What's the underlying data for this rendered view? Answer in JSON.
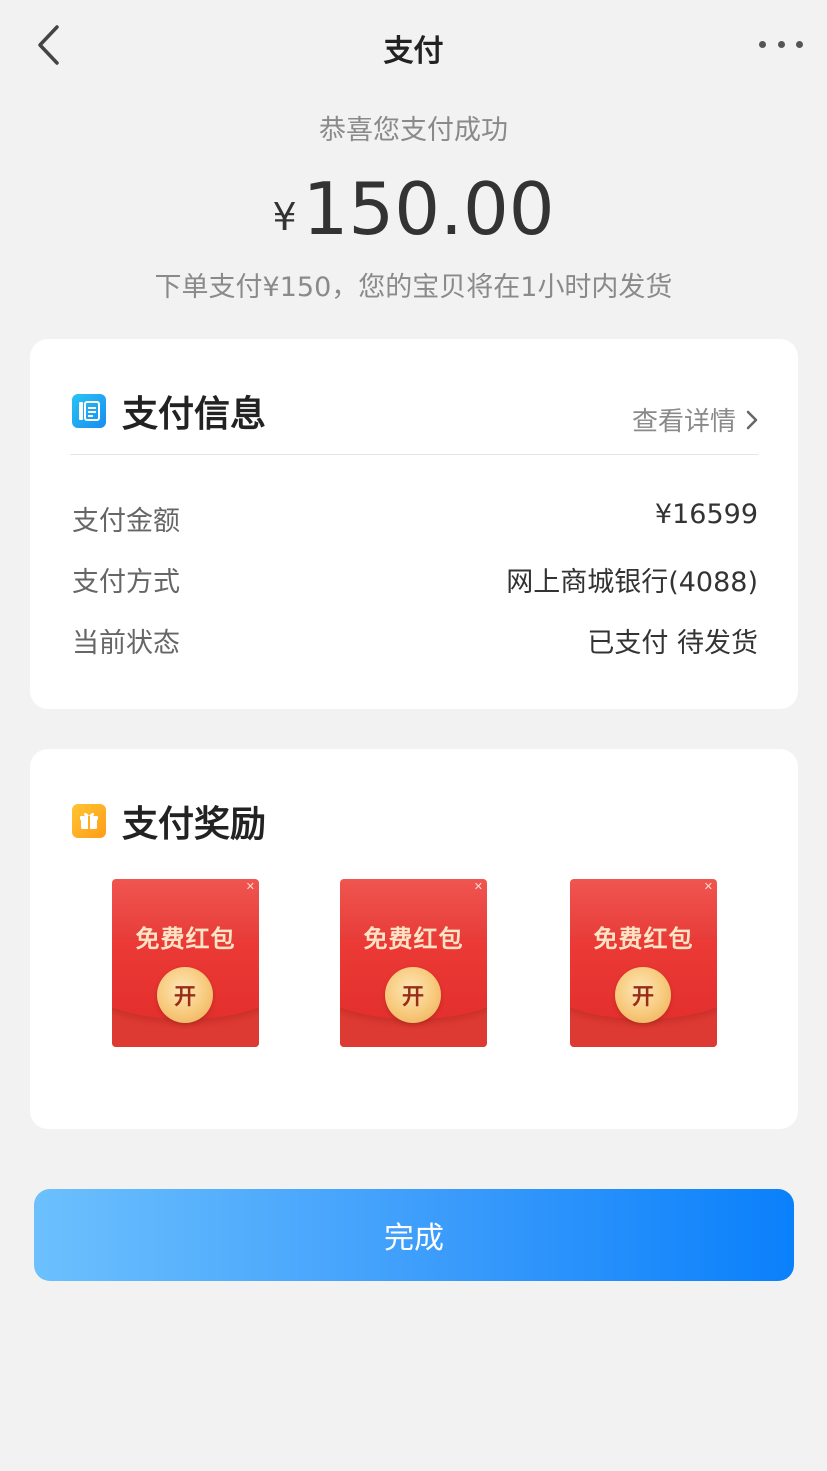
{
  "nav": {
    "title": "支付"
  },
  "hero": {
    "congrats": "恭喜您支付成功",
    "currency": "¥",
    "amount": "150.00",
    "note": "下单支付¥150，您的宝贝将在1小时内发货"
  },
  "payment_info": {
    "title": "支付信息",
    "detail_link": "查看详情",
    "rows": [
      {
        "label": "支付金额",
        "value": "¥16599"
      },
      {
        "label": "支付方式",
        "value": "网上商城银行(4088)"
      },
      {
        "label": "当前状态",
        "value": "已支付 待发货"
      }
    ]
  },
  "rewards": {
    "title": "支付奖励",
    "envelopes": [
      {
        "label": "免费红包",
        "button": "开"
      },
      {
        "label": "免费红包",
        "button": "开"
      },
      {
        "label": "免费红包",
        "button": "开"
      }
    ]
  },
  "done_button": "完成",
  "colors": {
    "page_bg": "#f2f2f2",
    "button_gradient_start": "#6cc0fd",
    "button_gradient_end": "#0a80fb",
    "envelope_red": "#e3302f"
  }
}
